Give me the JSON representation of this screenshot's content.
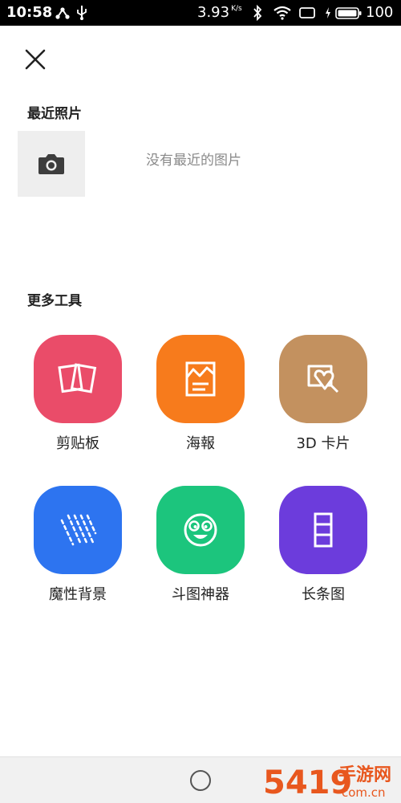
{
  "status_bar": {
    "time": "10:58",
    "speed_value": "3.93",
    "speed_unit": "K/s",
    "battery_level": "100"
  },
  "recent": {
    "title": "最近照片",
    "empty_text": "没有最近的图片"
  },
  "tools": {
    "title": "更多工具",
    "items": [
      {
        "label": "剪贴板",
        "color": "#ea4c69",
        "icon": "collage-icon"
      },
      {
        "label": "海報",
        "color": "#f77b1c",
        "icon": "poster-icon"
      },
      {
        "label": "3D 卡片",
        "color": "#c3915f",
        "icon": "3d-card-icon"
      },
      {
        "label": "魔性背景",
        "color": "#2d74f0",
        "icon": "pattern-icon"
      },
      {
        "label": "斗图神器",
        "color": "#1cc57d",
        "icon": "meme-face-icon"
      },
      {
        "label": "长条图",
        "color": "#6c3cdc",
        "icon": "long-image-icon"
      }
    ]
  },
  "watermark": {
    "digits": "5419",
    "brand": "手游网",
    "domain": "com.cn"
  }
}
